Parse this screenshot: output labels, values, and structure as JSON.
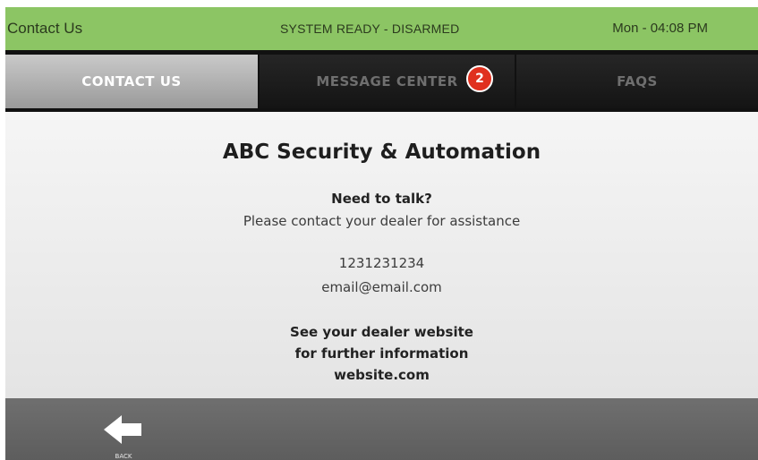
{
  "status_bar": {
    "screen_title": "Contact Us",
    "system_status": "SYSTEM READY - DISARMED",
    "clock": "Mon - 04:08 PM",
    "color": "#8cc564"
  },
  "tabs": [
    {
      "label": "CONTACT US",
      "active": true
    },
    {
      "label": "MESSAGE CENTER",
      "active": false,
      "badge_count": "2",
      "badge_color": "#e0301e"
    },
    {
      "label": "FAQS",
      "active": false
    }
  ],
  "contact": {
    "company": "ABC Security & Automation",
    "prompt": "Need to talk?",
    "instruction": "Please contact your dealer for assistance",
    "phone": "1231231234",
    "email": "email@email.com",
    "website_line1": "See your dealer website",
    "website_line2": "for further information",
    "website": "website.com"
  },
  "bottom_bar": {
    "back_label": "BACK",
    "back_icon": "arrow-left-icon"
  }
}
